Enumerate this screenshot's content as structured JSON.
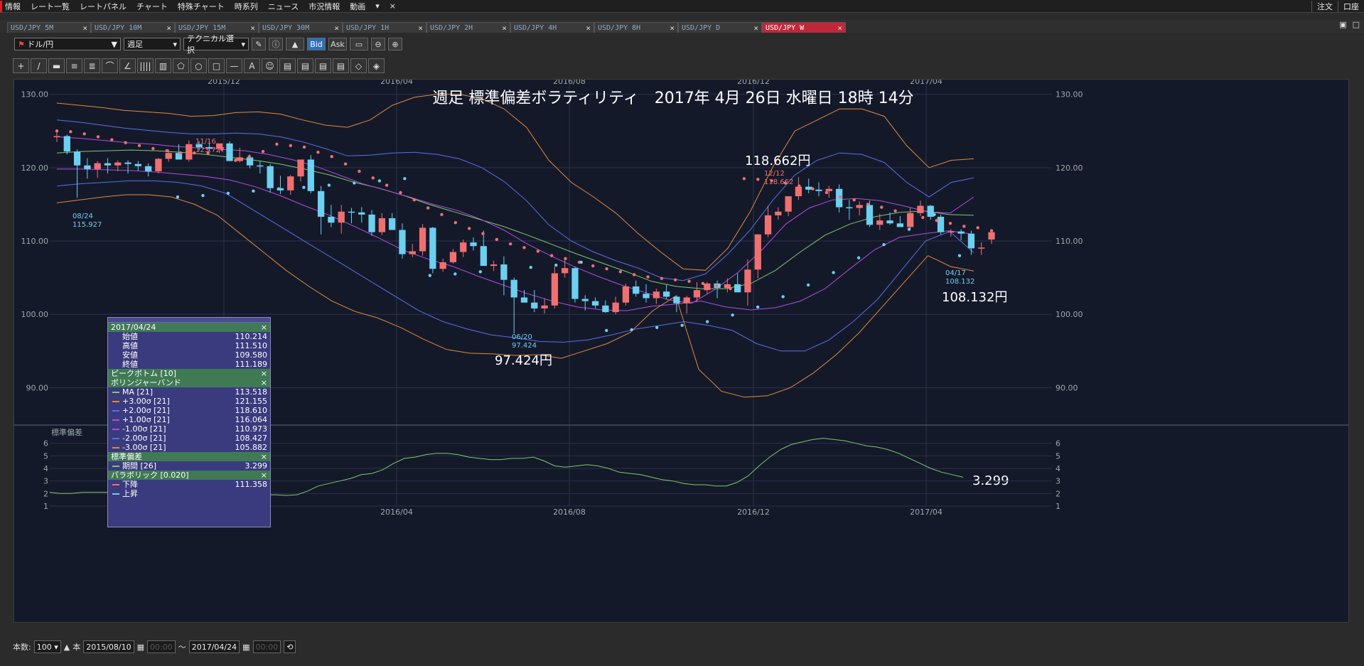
{
  "menubar": {
    "items": [
      "情報",
      "レート一覧",
      "レートパネル",
      "チャート",
      "特殊チャート",
      "時系列",
      "ニュース",
      "市況情報",
      "動画",
      "▾",
      "×"
    ],
    "right_items": [
      "注文",
      "口座"
    ]
  },
  "tabs": [
    {
      "label": "USD/JPY 5M",
      "active": false
    },
    {
      "label": "USD/JPY 10M",
      "active": false
    },
    {
      "label": "USD/JPY 15M",
      "active": false
    },
    {
      "label": "USD/JPY 30M",
      "active": false
    },
    {
      "label": "USD/JPY 1H",
      "active": false
    },
    {
      "label": "USD/JPY 2H",
      "active": false
    },
    {
      "label": "USD/JPY 4H",
      "active": false
    },
    {
      "label": "USD/JPY 8H",
      "active": false
    },
    {
      "label": "USD/JPY D",
      "active": false
    },
    {
      "label": "USD/JPY W",
      "active": true
    }
  ],
  "toolbar": {
    "pair": "ドル/円",
    "period": "週足",
    "technical": "テクニカル選択",
    "bid": "Bid",
    "ask": "Ask"
  },
  "drawing_tools": [
    "+",
    "/",
    "▬",
    "≡",
    "≣",
    "⌒",
    "∠",
    "||||",
    "▥",
    "⬠",
    "○",
    "□",
    "—",
    "A",
    "☺",
    "▤",
    "▤",
    "▤",
    "▤",
    "◇",
    "◈"
  ],
  "data_panel": {
    "date": "2017/04/24",
    "ohlc": [
      {
        "label": "始値",
        "value": "110.214"
      },
      {
        "label": "高値",
        "value": "111.510"
      },
      {
        "label": "安値",
        "value": "109.580"
      },
      {
        "label": "終値",
        "value": "111.189"
      }
    ],
    "peak_bottom": "ピークボトム [10]",
    "bollinger_title": "ボリンジャーバンド",
    "bollinger": [
      {
        "label": "MA [21]",
        "value": "113.518",
        "color": "#7ec86a"
      },
      {
        "label": "+3.00σ [21]",
        "value": "121.155",
        "color": "#e08a3a"
      },
      {
        "label": "+2.00σ [21]",
        "value": "118.610",
        "color": "#5a6ee6"
      },
      {
        "label": "+1.00σ [21]",
        "value": "116.064",
        "color": "#b04ee0"
      },
      {
        "label": "-1.00σ [21]",
        "value": "110.973",
        "color": "#b04ee0"
      },
      {
        "label": "-2.00σ [21]",
        "value": "108.427",
        "color": "#5a6ee6"
      },
      {
        "label": "-3.00σ [21]",
        "value": "105.882",
        "color": "#e08a3a"
      }
    ],
    "stddev_title": "標準偏差",
    "stddev_period": {
      "label": "期間 [26]",
      "value": "3.299",
      "color": "#7ec86a"
    },
    "parabolic_title": "パラボリック [0.020]",
    "parabolic": [
      {
        "label": "下降",
        "value": "111.358",
        "color": "#f07070"
      },
      {
        "label": "上昇",
        "value": "",
        "color": "#6cd0f0"
      }
    ],
    "close_mark": "×"
  },
  "bottombar": {
    "count_label": "本数:",
    "count": "100",
    "unit": "本",
    "from_date": "2015/08/10",
    "to_date": "2017/04/24",
    "time_placeholder": "00:00",
    "tilde": "〜"
  },
  "chart_data": {
    "type": "candlestick",
    "title": "週足 標準偏差ボラティリティ　2017年 4月 26日 水曜日 18時 14分",
    "ylim": [
      85,
      132
    ],
    "yticks": [
      "130.00",
      "120.00",
      "110.00",
      "100.00",
      "90.00"
    ],
    "xticks": [
      "2015/12",
      "2016/04",
      "2016/08",
      "2016/12",
      "2017/04"
    ],
    "grid": true,
    "candles": [
      [
        124.2,
        125.2,
        123.5,
        124.3
      ],
      [
        124.3,
        124.5,
        121.8,
        122.2
      ],
      [
        122.2,
        122.5,
        115.9,
        120.3
      ],
      [
        120.3,
        121.3,
        118.5,
        119.8
      ],
      [
        119.8,
        120.9,
        118.6,
        120.6
      ],
      [
        120.6,
        121.3,
        119.2,
        120.3
      ],
      [
        120.3,
        121.0,
        119.5,
        120.7
      ],
      [
        120.7,
        121.0,
        119.2,
        120.5
      ],
      [
        120.5,
        120.9,
        119.6,
        120.2
      ],
      [
        120.2,
        120.6,
        118.8,
        119.5
      ],
      [
        119.5,
        121.3,
        119.2,
        121.2
      ],
      [
        121.2,
        122.5,
        120.8,
        122.0
      ],
      [
        122.0,
        123.2,
        121.8,
        121.1
      ],
      [
        121.1,
        123.7,
        120.8,
        123.2
      ],
      [
        123.2,
        123.6,
        122.3,
        122.8
      ],
      [
        122.8,
        123.7,
        122.2,
        122.6
      ],
      [
        122.6,
        123.2,
        122.0,
        123.3
      ],
      [
        123.3,
        123.6,
        122.3,
        120.9
      ],
      [
        120.9,
        122.7,
        120.7,
        121.4
      ],
      [
        121.4,
        121.8,
        119.9,
        120.3
      ],
      [
        120.3,
        120.9,
        119.2,
        120.2
      ],
      [
        120.2,
        120.5,
        116.6,
        117.2
      ],
      [
        117.2,
        118.9,
        116.4,
        116.9
      ],
      [
        116.9,
        119.0,
        116.3,
        118.8
      ],
      [
        118.8,
        121.1,
        118.1,
        121.1
      ],
      [
        121.1,
        121.7,
        116.5,
        116.8
      ],
      [
        116.8,
        117.5,
        110.9,
        113.3
      ],
      [
        113.3,
        114.9,
        111.9,
        112.5
      ],
      [
        112.5,
        114.9,
        111.0,
        114.0
      ],
      [
        114.0,
        114.5,
        112.4,
        113.9
      ],
      [
        113.9,
        114.6,
        112.5,
        113.6
      ],
      [
        113.6,
        114.2,
        110.7,
        111.2
      ],
      [
        111.2,
        113.8,
        110.8,
        113.1
      ],
      [
        113.1,
        113.8,
        111.5,
        111.5
      ],
      [
        111.5,
        112.4,
        107.6,
        108.2
      ],
      [
        108.2,
        109.6,
        107.8,
        108.6
      ],
      [
        108.6,
        112.3,
        108.0,
        111.8
      ],
      [
        111.8,
        111.9,
        105.6,
        106.2
      ],
      [
        106.2,
        107.6,
        105.8,
        107.1
      ],
      [
        107.1,
        108.9,
        106.9,
        108.5
      ],
      [
        108.5,
        110.2,
        107.8,
        109.8
      ],
      [
        109.8,
        110.5,
        108.7,
        109.3
      ],
      [
        109.3,
        111.4,
        108.5,
        106.6
      ],
      [
        106.6,
        107.3,
        105.9,
        106.8
      ],
      [
        106.8,
        107.9,
        102.6,
        104.7
      ],
      [
        104.7,
        105.0,
        97.4,
        102.3
      ],
      [
        102.3,
        103.3,
        101.8,
        101.6
      ],
      [
        101.6,
        103.3,
        100.3,
        100.8
      ],
      [
        100.8,
        102.2,
        100.1,
        101.2
      ],
      [
        101.2,
        106.5,
        100.8,
        105.6
      ],
      [
        105.6,
        107.5,
        105.0,
        106.3
      ],
      [
        106.3,
        106.5,
        101.6,
        102.1
      ],
      [
        102.1,
        102.6,
        100.5,
        101.8
      ],
      [
        101.8,
        102.3,
        100.8,
        101.2
      ],
      [
        101.2,
        101.9,
        100.2,
        100.3
      ],
      [
        100.3,
        102.4,
        100.0,
        101.6
      ],
      [
        101.6,
        104.2,
        101.2,
        103.8
      ],
      [
        103.8,
        104.6,
        102.4,
        102.8
      ],
      [
        102.8,
        104.1,
        101.6,
        102.2
      ],
      [
        102.2,
        103.5,
        101.4,
        103.1
      ],
      [
        103.1,
        104.1,
        102.1,
        102.4
      ],
      [
        102.4,
        102.6,
        100.3,
        101.5
      ],
      [
        101.5,
        102.5,
        100.1,
        102.3
      ],
      [
        102.3,
        104.4,
        101.7,
        103.3
      ],
      [
        103.3,
        104.4,
        102.8,
        104.2
      ],
      [
        104.2,
        104.6,
        102.2,
        103.6
      ],
      [
        103.6,
        104.9,
        103.0,
        104.1
      ],
      [
        104.1,
        105.6,
        103.2,
        103.0
      ],
      [
        103.0,
        107.5,
        101.2,
        106.1
      ],
      [
        106.1,
        110.9,
        104.9,
        110.9
      ],
      [
        110.9,
        114.8,
        110.5,
        113.5
      ],
      [
        113.5,
        114.6,
        112.9,
        114.0
      ],
      [
        114.0,
        116.1,
        113.4,
        116.1
      ],
      [
        116.1,
        118.7,
        115.6,
        117.4
      ],
      [
        117.4,
        118.5,
        116.5,
        117.0
      ],
      [
        117.0,
        118.0,
        116.1,
        116.8
      ],
      [
        116.8,
        117.5,
        115.9,
        117.1
      ],
      [
        117.1,
        117.7,
        113.9,
        114.6
      ],
      [
        114.6,
        115.6,
        112.9,
        114.5
      ],
      [
        114.5,
        115.4,
        113.5,
        114.9
      ],
      [
        114.9,
        115.5,
        111.9,
        112.2
      ],
      [
        112.2,
        113.7,
        111.5,
        112.8
      ],
      [
        112.8,
        113.9,
        112.2,
        112.4
      ],
      [
        112.4,
        113.4,
        111.9,
        111.9
      ],
      [
        111.9,
        114.5,
        111.7,
        113.8
      ],
      [
        113.8,
        115.5,
        113.4,
        114.8
      ],
      [
        114.8,
        114.9,
        112.9,
        113.3
      ],
      [
        113.3,
        113.6,
        110.9,
        111.2
      ],
      [
        111.2,
        111.6,
        110.6,
        111.3
      ],
      [
        111.3,
        111.6,
        110.1,
        111.0
      ],
      [
        111.0,
        111.4,
        108.1,
        109.0
      ],
      [
        109.0,
        109.8,
        108.1,
        109.1
      ],
      [
        110.2,
        111.5,
        109.6,
        111.2
      ]
    ],
    "bands": {
      "ma": [
        122.0,
        122.2,
        122.3,
        122.4,
        122.3,
        122.1,
        121.8,
        121.4,
        121.0,
        120.5,
        119.8,
        119.0,
        118.0,
        117.2,
        116.2,
        115.0,
        114.0,
        113.0,
        112.0,
        110.8,
        109.5,
        108.2,
        107.0,
        105.8,
        104.5,
        103.8,
        103.5,
        103.5,
        104.2,
        106.0,
        108.5,
        110.8,
        112.3,
        113.3,
        113.9,
        114.1,
        113.6,
        113.5
      ],
      "up3": [
        128.8,
        128.5,
        128.2,
        127.8,
        127.6,
        127.4,
        127.0,
        127.1,
        127.5,
        127.6,
        127.3,
        126.5,
        125.8,
        125.5,
        126.5,
        128.5,
        129.6,
        130.0,
        130.0,
        129.4,
        128.0,
        125.5,
        121.0,
        118.0,
        116.0,
        113.8,
        111.0,
        108.5,
        106.2,
        106.0,
        109.0,
        114.0,
        120.0,
        125.0,
        126.5,
        128.0,
        128.0,
        127.0,
        123.0,
        120.0,
        121.0,
        121.2
      ],
      "up2": [
        126.5,
        126.2,
        125.8,
        125.4,
        125.1,
        124.8,
        124.6,
        124.6,
        124.7,
        124.6,
        124.2,
        123.5,
        122.6,
        121.6,
        121.7,
        122.0,
        122.1,
        121.8,
        121.2,
        120.0,
        118.1,
        115.5,
        112.2,
        110.0,
        108.5,
        107.3,
        106.3,
        105.0,
        104.6,
        105.5,
        108.2,
        111.5,
        115.5,
        119.0,
        121.0,
        122.0,
        121.8,
        120.7,
        118.0,
        116.0,
        118.0,
        118.6
      ],
      "up1": [
        124.2,
        124.0,
        123.7,
        123.4,
        123.2,
        122.9,
        122.7,
        122.5,
        122.3,
        121.8,
        121.1,
        120.2,
        119.0,
        117.8,
        116.9,
        116.0,
        115.0,
        114.2,
        113.0,
        111.5,
        109.6,
        108.0,
        106.5,
        105.2,
        104.0,
        103.0,
        102.0,
        101.5,
        103.4,
        105.8,
        108.8,
        112.3,
        114.5,
        115.6,
        115.8,
        115.5,
        114.8,
        114.0,
        113.8,
        116.0
      ],
      "dn1": [
        119.8,
        119.8,
        119.7,
        119.6,
        119.4,
        119.1,
        118.8,
        118.3,
        117.4,
        116.2,
        114.8,
        113.5,
        112.0,
        110.4,
        108.7,
        107.5,
        106.5,
        105.2,
        104.0,
        102.8,
        101.8,
        101.0,
        100.6,
        100.5,
        101.1,
        101.4,
        101.8,
        101.0,
        100.6,
        100.9,
        101.8,
        103.5,
        106.2,
        108.8,
        110.5,
        111.0,
        111.4,
        110.9
      ],
      "dn2": [
        117.5,
        117.8,
        118.0,
        118.2,
        118.2,
        118.0,
        117.5,
        116.5,
        114.5,
        112.5,
        110.5,
        108.5,
        106.5,
        104.5,
        102.5,
        100.5,
        99.0,
        98.0,
        97.2,
        96.8,
        96.3,
        96.2,
        96.5,
        97.2,
        98.0,
        98.5,
        99.0,
        98.5,
        97.8,
        96.0,
        95.0,
        95.0,
        96.5,
        99.0,
        102.0,
        106.0,
        110.0,
        111.3,
        108.4
      ],
      "dn3": [
        115.2,
        115.6,
        116.0,
        116.3,
        116.3,
        116.0,
        115.0,
        113.5,
        111.0,
        108.5,
        106.0,
        103.8,
        101.8,
        100.4,
        99.5,
        98.2,
        96.6,
        95.2,
        94.7,
        94.6,
        94.4,
        94.5,
        94.0,
        95.0,
        96.0,
        97.5,
        100.5,
        102.5,
        92.5,
        89.5,
        88.7,
        88.9,
        90.0,
        92.0,
        94.5,
        97.5,
        101.0,
        104.5,
        108.0,
        106.5,
        105.9
      ]
    },
    "sar_down": [
      125.0,
      124.9,
      124.6,
      124.2,
      123.8,
      123.4,
      123.0,
      122.6,
      122.3,
      122.0,
      122.0,
      122.0,
      122.5,
      121.0,
      121.5,
      122.2,
      123.2,
      123.0,
      122.8,
      122.1,
      121.5,
      120.5,
      119.5,
      118.6,
      117.6,
      116.6,
      115.6,
      114.5,
      113.6,
      112.5,
      111.7,
      111.0,
      110.2,
      109.6,
      109.1,
      108.6,
      108.0,
      107.6,
      107.1,
      106.6,
      106.2,
      105.8,
      105.4,
      105.1,
      104.9,
      104.7,
      104.5,
      104.2,
      103.9,
      103.5,
      118.5,
      118.4,
      118.2,
      117.9,
      117.5,
      117.1,
      116.6,
      116.0,
      115.6,
      115.0,
      114.6,
      114.1,
      113.6,
      113.2,
      112.8,
      112.4,
      112.0,
      111.8,
      111.4
    ],
    "sar_up": [
      116.0,
      116.2,
      116.5,
      116.8,
      117.1,
      117.3,
      117.6,
      117.9,
      118.2,
      118.5,
      105.3,
      105.5,
      105.8,
      106.1,
      106.4,
      106.7,
      107.1,
      97.8,
      97.9,
      98.2,
      98.5,
      99.0,
      99.9,
      101.0,
      102.4,
      104.0,
      105.7,
      107.7,
      109.5,
      111.6,
      113.6,
      108.0
    ],
    "annotations": [
      {
        "date": "11/16",
        "value": "123.727"
      },
      {
        "date": "08/24",
        "value": "115.927"
      },
      {
        "date": "06/20",
        "value": "97.424"
      },
      {
        "date": "12/12",
        "value": "118.662"
      },
      {
        "date": "04/17",
        "value": "108.132"
      }
    ],
    "big_labels": [
      "118.662円",
      "97.424円",
      "108.132円",
      "3.299"
    ],
    "stddev": {
      "title": "標準偏差",
      "ylim": [
        1,
        7
      ],
      "yticks": [
        "6",
        "5",
        "4",
        "3",
        "2",
        "1"
      ],
      "values": [
        2.1,
        2.0,
        2.0,
        2.1,
        2.1,
        2.1,
        2.1,
        2.0,
        2.0,
        2.0,
        1.9,
        1.9,
        1.8,
        1.8,
        1.7,
        1.6,
        1.6,
        1.6,
        1.7,
        1.8,
        1.9,
        1.9,
        1.85,
        1.9,
        2.2,
        2.6,
        2.8,
        3.0,
        3.2,
        3.5,
        3.6,
        3.9,
        4.4,
        4.8,
        4.9,
        5.1,
        5.2,
        5.2,
        5.1,
        4.9,
        4.8,
        4.7,
        4.7,
        4.8,
        4.8,
        4.9,
        4.6,
        4.2,
        4.1,
        4.2,
        4.3,
        4.2,
        4.0,
        3.7,
        3.6,
        3.5,
        3.3,
        3.1,
        3.0,
        2.8,
        2.7,
        2.7,
        2.6,
        2.6,
        2.9,
        3.4,
        4.2,
        4.9,
        5.5,
        5.9,
        6.1,
        6.3,
        6.4,
        6.3,
        6.2,
        6.0,
        5.8,
        5.7,
        5.5,
        5.2,
        4.8,
        4.4,
        4.0,
        3.7,
        3.5,
        3.299
      ]
    }
  }
}
